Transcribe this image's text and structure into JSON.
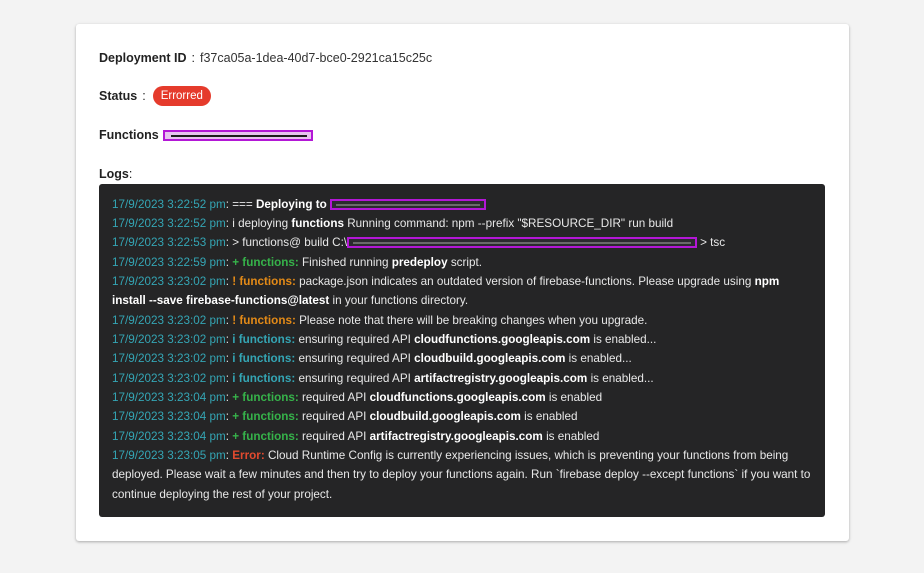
{
  "deployment": {
    "id_label": "Deployment ID",
    "sep": ":",
    "id_value": "f37ca05a-1dea-40d7-bce0-2921ca15c25c",
    "status_label": "Status",
    "status_value": "Errorred",
    "functions_label": "Functions",
    "logs_label": "Logs",
    "logs_colon": ":"
  },
  "colors": {
    "status_badge": "#e53b2c",
    "timestamp": "#34a5b4",
    "success": "#36b24a",
    "warning": "#e38a17",
    "error": "#e24a2f",
    "log_background": "#252526",
    "redaction": "#b317d6"
  },
  "logs": [
    {
      "ts": "17/9/2023 3:22:52 pm",
      "sep": ": ",
      "a": "=== ",
      "b": "Deploying to "
    },
    {
      "ts": "17/9/2023 3:22:52 pm",
      "sep": ": ",
      "a": "i deploying ",
      "b": "functions",
      "c": " Running command: npm --prefix \"$RESOURCE_DIR\" run build"
    },
    {
      "ts": "17/9/2023 3:22:53 pm",
      "sep": ": ",
      "a": "> functions@ build C:\\",
      "b": "> tsc"
    },
    {
      "ts": "17/9/2023 3:22:59 pm",
      "sep": ": ",
      "lvl": "+ functions:",
      "a": " Finished running ",
      "b": "predeploy",
      "c": " script."
    },
    {
      "ts": "17/9/2023 3:23:02 pm",
      "sep": ": ",
      "lvl": "! functions:",
      "a": " package.json indicates an outdated version of firebase-functions. Please upgrade using ",
      "b": "npm install --save firebase-functions@latest",
      "c": " in your functions directory."
    },
    {
      "ts": "17/9/2023 3:23:02 pm",
      "sep": ": ",
      "lvl": "! functions:",
      "a": " Please note that there will be breaking changes when you upgrade."
    },
    {
      "ts": "17/9/2023 3:23:02 pm",
      "sep": ": ",
      "lvl": "i functions:",
      "a": " ensuring required API ",
      "b": "cloudfunctions.googleapis.com",
      "c": " is enabled..."
    },
    {
      "ts": "17/9/2023 3:23:02 pm",
      "sep": ": ",
      "lvl": "i functions:",
      "a": " ensuring required API ",
      "b": "cloudbuild.googleapis.com",
      "c": " is enabled..."
    },
    {
      "ts": "17/9/2023 3:23:02 pm",
      "sep": ": ",
      "lvl": "i functions:",
      "a": " ensuring required API ",
      "b": "artifactregistry.googleapis.com",
      "c": " is enabled..."
    },
    {
      "ts": "17/9/2023 3:23:04 pm",
      "sep": ": ",
      "lvl": "+ functions:",
      "a": " required API ",
      "b": "cloudfunctions.googleapis.com",
      "c": " is enabled"
    },
    {
      "ts": "17/9/2023 3:23:04 pm",
      "sep": ": ",
      "lvl": "+ functions:",
      "a": " required API ",
      "b": "cloudbuild.googleapis.com",
      "c": " is enabled"
    },
    {
      "ts": "17/9/2023 3:23:04 pm",
      "sep": ": ",
      "lvl": "+ functions:",
      "a": " required API ",
      "b": "artifactregistry.googleapis.com",
      "c": " is enabled"
    },
    {
      "ts": "17/9/2023 3:23:05 pm",
      "sep": ": ",
      "lvl": "Error:",
      "a": " Cloud Runtime Config is currently experiencing issues, which is preventing your functions from being deployed. Please wait a few minutes and then try to deploy your functions again. Run `firebase deploy --except functions` if you want to continue deploying the rest of your project."
    }
  ]
}
